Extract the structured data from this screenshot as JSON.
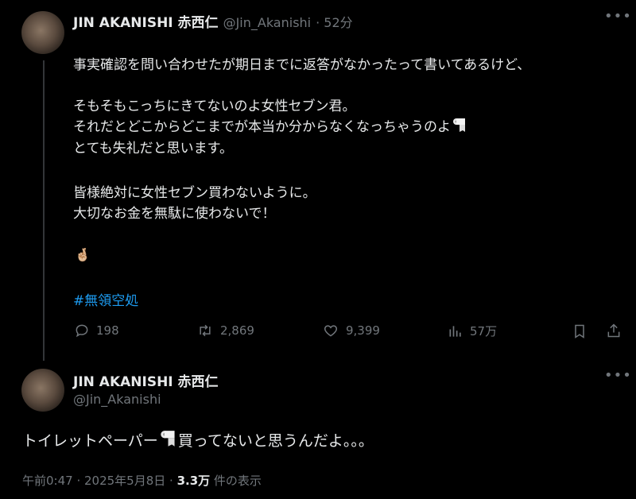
{
  "tweet1": {
    "author_name": "JIN AKANISHI 赤西仁",
    "author_handle": "@Jin_Akanishi",
    "time_ago": "· 52分",
    "lines": [
      "事実確認を問い合わせたが期日までに返答がなかったって書いてあるけど、",
      "そもそもこっちにきてないのよ女性セブン君。",
      "それだとどこからどこまでが本当か分からなくなっちゃうのよ",
      "とても失礼だと思います。",
      "皆様絶対に女性セブン買わないように。",
      "大切なお金を無駄に使わないで！"
    ],
    "emoji": "🤞🏼",
    "hashtag": "#無領空処",
    "actions": {
      "replies": "198",
      "reposts": "2,869",
      "likes": "9,399",
      "views": "57万"
    }
  },
  "tweet2": {
    "author_name": "JIN AKANISHI 赤西仁",
    "author_handle": "@Jin_Akanishi",
    "text_before": "トイレットペーパー",
    "text_after": "買ってないと思うんだよ。。。",
    "timestamp": "午前0:47 · 2025年5月8日 · ",
    "view_count": "3.3万",
    "view_label": " 件の表示"
  },
  "colors": {
    "accent": "#1d9bf0",
    "muted": "#71767b",
    "text": "#e7e9ea",
    "background": "#000000"
  },
  "icons": [
    "more-icon",
    "reply-icon",
    "repost-icon",
    "like-icon",
    "views-icon",
    "bookmark-icon",
    "share-icon",
    "toilet-paper-icon"
  ]
}
